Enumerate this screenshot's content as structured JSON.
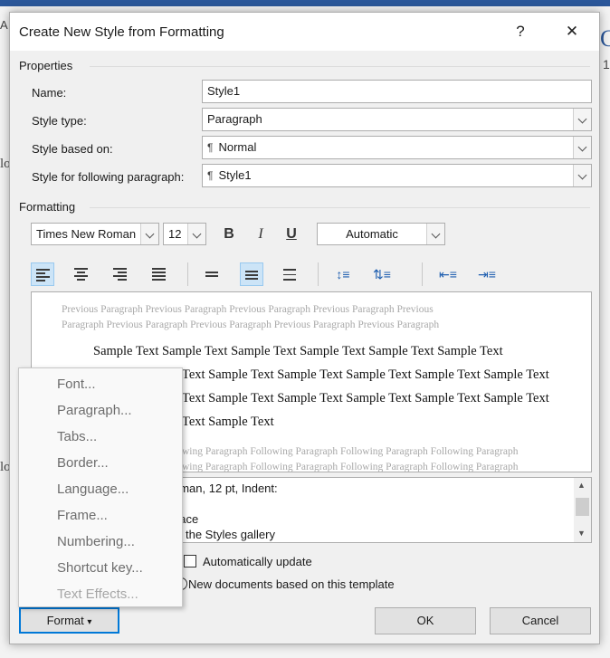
{
  "background": {
    "fragment_a": "A",
    "fragment_c": "C",
    "fragment_1": "1",
    "fragment_lo1": "lo",
    "fragment_lo2": "lo"
  },
  "dialog": {
    "title": "Create New Style from Formatting",
    "help_label": "?",
    "close_label": "✕"
  },
  "properties": {
    "heading": "Properties",
    "name_label": "Name:",
    "name_value": "Style1",
    "style_type_label": "Style type:",
    "style_type_value": "Paragraph",
    "based_on_label": "Style based on:",
    "based_on_value": "Normal",
    "following_label": "Style for following paragraph:",
    "following_value": "Style1"
  },
  "formatting": {
    "heading": "Formatting",
    "font_name": "Times New Roman",
    "font_size": "12",
    "bold_label": "B",
    "italic_label": "I",
    "underline_label": "U",
    "color_value": "Automatic"
  },
  "preview": {
    "previous_line1": "Previous Paragraph Previous Paragraph Previous Paragraph Previous Paragraph Previous",
    "previous_line2": "Paragraph Previous Paragraph Previous Paragraph Previous Paragraph Previous Paragraph",
    "sample_line1": "Sample Text Sample Text Sample Text Sample Text Sample Text Sample Text",
    "sample_line2": "Text Sample Text Sample Text Sample Text Sample Text Sample Text",
    "sample_line3": "Text Sample Text Sample Text Sample Text Sample Text Sample Text",
    "sample_line4": "Text Sample Text",
    "following_line1": "wing Paragraph Following Paragraph Following Paragraph Following Paragraph",
    "following_line2": "wing Paragraph Following Paragraph Following Paragraph Following Paragraph"
  },
  "description": {
    "line1": "oman, 12 pt, Indent:",
    "line2": "pace",
    "line3": "the Styles gallery"
  },
  "options": {
    "auto_update_label": "Automatically update",
    "new_docs_label": "New documents based on this template"
  },
  "buttons": {
    "format_label": "Format",
    "ok_label": "OK",
    "cancel_label": "Cancel"
  },
  "format_menu": {
    "items": [
      {
        "label": "Font...",
        "enabled": true
      },
      {
        "label": "Paragraph...",
        "enabled": true
      },
      {
        "label": "Tabs...",
        "enabled": true
      },
      {
        "label": "Border...",
        "enabled": true
      },
      {
        "label": "Language...",
        "enabled": true
      },
      {
        "label": "Frame...",
        "enabled": true
      },
      {
        "label": "Numbering...",
        "enabled": true
      },
      {
        "label": "Shortcut key...",
        "enabled": true
      },
      {
        "label": "Text Effects...",
        "enabled": false
      }
    ]
  },
  "icons": {
    "bullet": "▾"
  }
}
